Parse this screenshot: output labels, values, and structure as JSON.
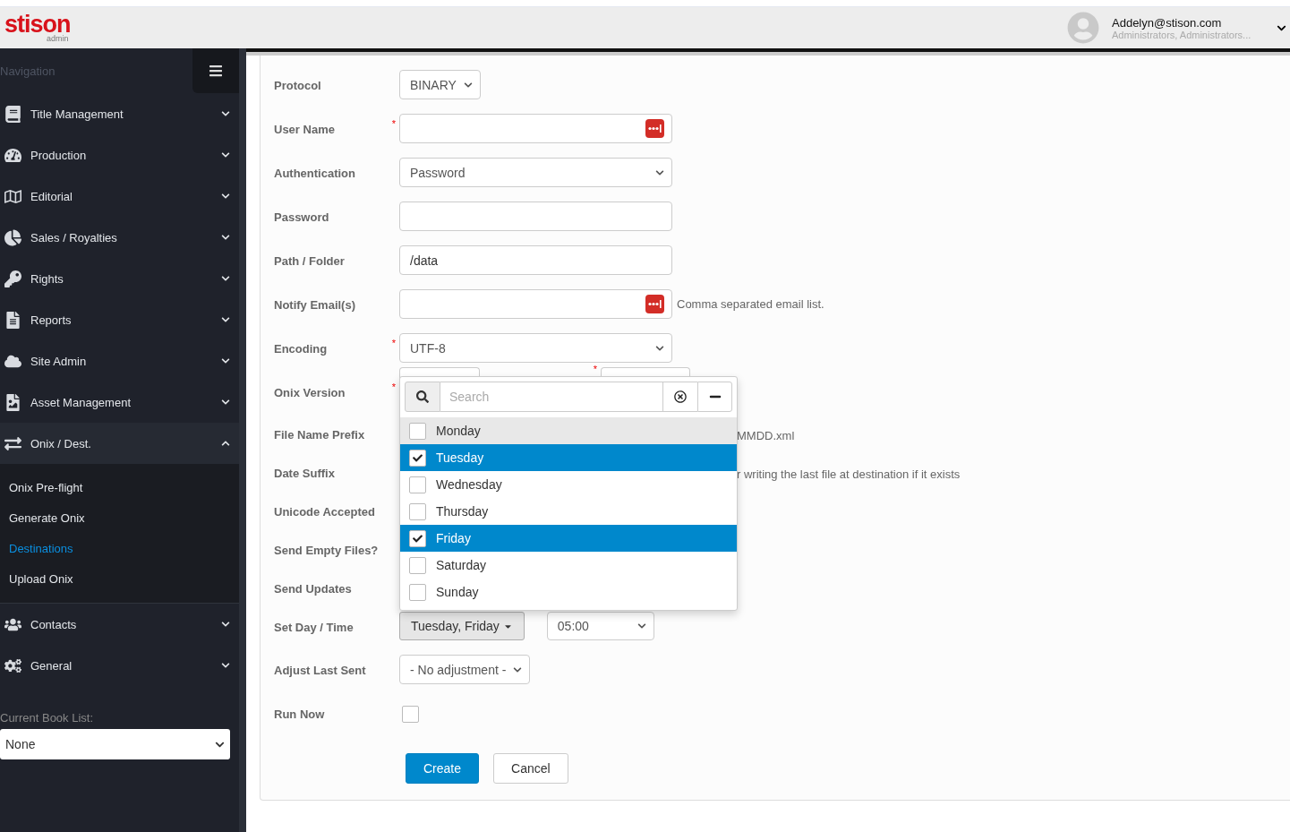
{
  "header": {
    "logo": {
      "text": "stison",
      "sub": "admin"
    },
    "user": {
      "email": "Addelyn@stison.com",
      "groups": "Administrators, Administrators..."
    }
  },
  "sidebar": {
    "title": "Navigation",
    "items": [
      {
        "label": "Title Management",
        "expanded": false
      },
      {
        "label": "Production",
        "expanded": false
      },
      {
        "label": "Editorial",
        "expanded": false
      },
      {
        "label": "Sales / Royalties",
        "expanded": false
      },
      {
        "label": "Rights",
        "expanded": false
      },
      {
        "label": "Reports",
        "expanded": false
      },
      {
        "label": "Site Admin",
        "expanded": false
      },
      {
        "label": "Asset Management",
        "expanded": false
      },
      {
        "label": "Onix / Dest.",
        "expanded": true,
        "children": [
          {
            "label": "Onix Pre-flight",
            "selected": false
          },
          {
            "label": "Generate Onix",
            "selected": false
          },
          {
            "label": "Destinations",
            "selected": true
          },
          {
            "label": "Upload Onix",
            "selected": false
          }
        ]
      },
      {
        "label": "Contacts",
        "expanded": false
      },
      {
        "label": "General",
        "expanded": false
      }
    ],
    "book_list": {
      "label": "Current Book List:",
      "value": "None"
    }
  },
  "form": {
    "fields": [
      {
        "kind": "select",
        "label": "Protocol",
        "value": "BINARY"
      },
      {
        "kind": "secret",
        "label": "User Name",
        "required_mark": "*"
      },
      {
        "kind": "wide-select",
        "label": "Authentication",
        "value": "Password"
      },
      {
        "kind": "input",
        "label": "Password"
      },
      {
        "kind": "input",
        "label": "Path / Folder",
        "value": "/data"
      },
      {
        "kind": "secret",
        "label": "Notify Email(s)",
        "hint": "Comma separated email list."
      },
      {
        "kind": "wide-select",
        "label": "Encoding",
        "required_mark": "*",
        "value": "UTF-8"
      },
      {
        "kind": "covered-pair",
        "label": "Onix Version",
        "required_mark": "*",
        "second_required_mark": "*"
      },
      {
        "kind": "covered",
        "label": "File Name Prefix",
        "hint": "MMDD.xml"
      },
      {
        "kind": "covered",
        "label": "Date Suffix",
        "hint": "r writing the last file at destination if it exists"
      },
      {
        "kind": "covered",
        "label": "Unicode Accepted"
      },
      {
        "kind": "covered",
        "label": "Send Empty Files?"
      },
      {
        "kind": "covered",
        "label": "Send Updates"
      },
      {
        "kind": "day-time",
        "label": "Set Day / Time",
        "days": "Tuesday, Friday",
        "time": "05:00"
      },
      {
        "kind": "select",
        "label": "Adjust Last Sent",
        "value": "- No adjustment -"
      },
      {
        "kind": "checkbox",
        "label": "Run Now",
        "checked": false
      }
    ],
    "buttons": [
      {
        "label": "Create",
        "kind": "primary"
      },
      {
        "label": "Cancel",
        "kind": "default"
      }
    ]
  },
  "day_picker": {
    "search_placeholder": "Search",
    "items": [
      {
        "label": "Monday",
        "checked": false,
        "hovered": true
      },
      {
        "label": "Tuesday",
        "checked": true,
        "hovered": false
      },
      {
        "label": "Wednesday",
        "checked": false,
        "hovered": false
      },
      {
        "label": "Thursday",
        "checked": false,
        "hovered": false
      },
      {
        "label": "Friday",
        "checked": true,
        "hovered": false
      },
      {
        "label": "Saturday",
        "checked": false,
        "hovered": false
      },
      {
        "label": "Sunday",
        "checked": false,
        "hovered": false
      }
    ]
  }
}
